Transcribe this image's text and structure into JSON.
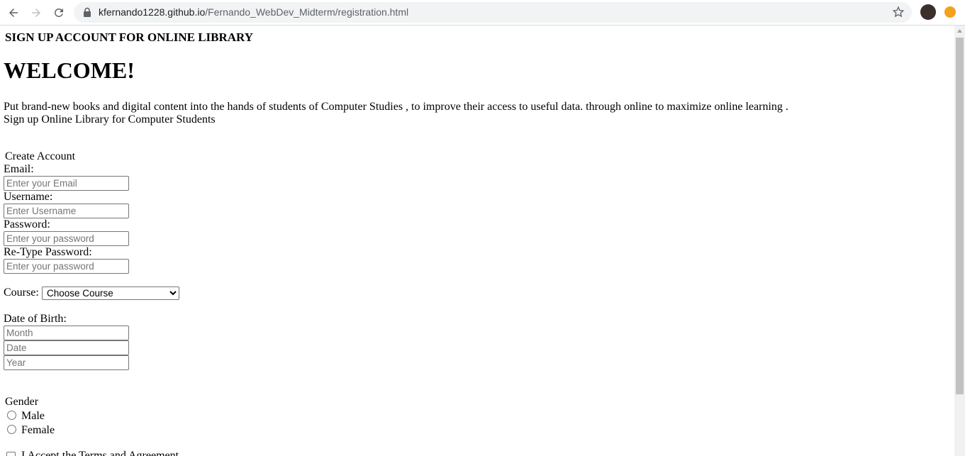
{
  "browser": {
    "url_host": "kfernando1228.github.io",
    "url_path": "/Fernando_WebDev_Midterm/registration.html"
  },
  "page": {
    "header": "SIGN UP ACCOUNT FOR ONLINE LIBRARY",
    "welcome": "WELCOME!",
    "intro": "Put brand-new books and digital content into the hands of students of Computer Studies , to improve their access to useful data. through online to maximize online learning .",
    "intro2": "Sign up Online Library for Computer Students"
  },
  "form": {
    "legend": "Create Account",
    "email_label": "Email:",
    "email_placeholder": "Enter your Email",
    "username_label": "Username:",
    "username_placeholder": "Enter Username",
    "password_label": "Password:",
    "password_placeholder": "Enter your password",
    "retype_label": "Re-Type Password:",
    "retype_placeholder": "Enter your password",
    "course_label": "Course:",
    "course_selected": "Choose Course",
    "dob_label": "Date of Birth:",
    "month_placeholder": "Month",
    "date_placeholder": "Date",
    "year_placeholder": "Year",
    "gender_legend": "Gender",
    "male_label": "Male",
    "female_label": "Female",
    "terms_label": "I Accept the Terms and Agreement"
  }
}
